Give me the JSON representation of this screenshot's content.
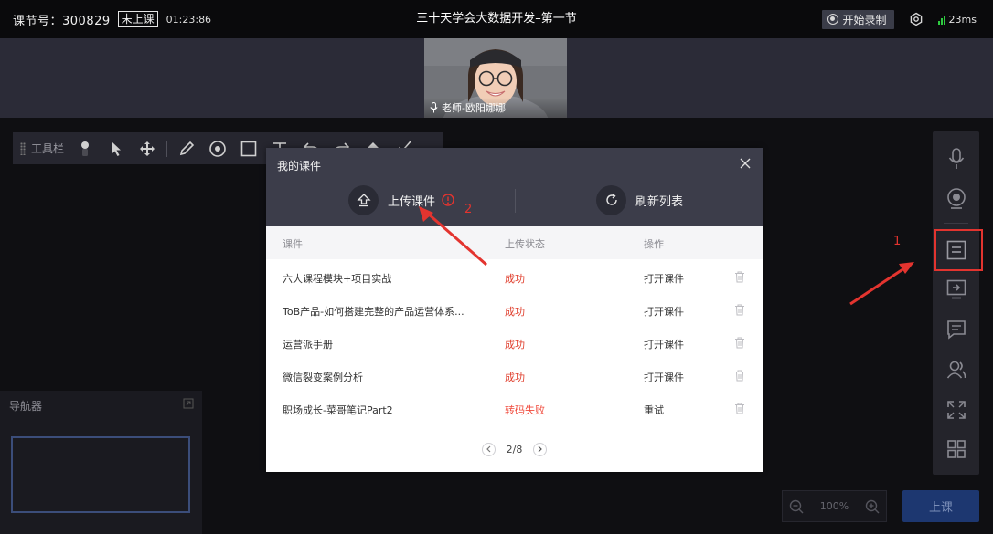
{
  "topbar": {
    "lesson_label": "课节号：300829",
    "status_badge": "未上课",
    "timer": "01:23:86",
    "title": "三十天学会大数据开发–第一节",
    "record_button": "开始录制",
    "latency": "23ms"
  },
  "video": {
    "teacher_label": "老师-欧阳娜娜"
  },
  "toolbar": {
    "label": "工具栏"
  },
  "navigator": {
    "title": "导航器"
  },
  "zoom": {
    "level": "100%"
  },
  "start_button": "上课",
  "modal": {
    "title": "我的课件",
    "upload_label": "上传课件",
    "refresh_label": "刷新列表",
    "columns": [
      "课件",
      "上传状态",
      "操作"
    ],
    "rows": [
      {
        "name": "六大课程模块+项目实战",
        "status": "成功",
        "action": "打开课件"
      },
      {
        "name": "ToB产品-如何搭建完整的产品运营体系...",
        "status": "成功",
        "action": "打开课件"
      },
      {
        "name": "运营派手册",
        "status": "成功",
        "action": "打开课件"
      },
      {
        "name": "微信裂变案例分析",
        "status": "成功",
        "action": "打开课件"
      },
      {
        "name": "职场成长-菜哥笔记Part2",
        "status": "转码失败",
        "action": "重试"
      }
    ],
    "pagination": "2/8"
  },
  "annotations": {
    "step1": "1",
    "step2": "2"
  },
  "colors": {
    "accent_red": "#e3342f",
    "signal_green": "#2ecc40",
    "primary_blue": "#1d3770"
  }
}
